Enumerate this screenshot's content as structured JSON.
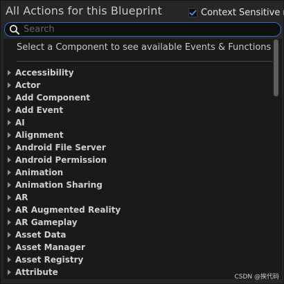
{
  "header": {
    "title": "All Actions for this Blueprint",
    "context_sensitive_label": "Context Sensitive",
    "context_sensitive_checked": true
  },
  "search": {
    "placeholder": "Search",
    "value": ""
  },
  "list": {
    "hint": "Select a Component to see available Events & Functions",
    "items": [
      "Accessibility",
      "Actor",
      "Add Component",
      "Add Event",
      "AI",
      "Alignment",
      "Android File Server",
      "Android Permission",
      "Animation",
      "Animation Sharing",
      "AR",
      "AR Augmented Reality",
      "AR Gameplay",
      "Asset Data",
      "Asset Manager",
      "Asset Registry",
      "Attribute"
    ]
  },
  "watermark": "CSDN @挨代码",
  "colors": {
    "accent": "#2f6fd1",
    "background": "#262626",
    "list_background": "#1a1a1a"
  },
  "icons": {
    "search": "search-icon",
    "checkbox_check": "checkmark-icon",
    "context_arrow": "chevron-right-icon",
    "item_caret": "caret-right-icon"
  }
}
